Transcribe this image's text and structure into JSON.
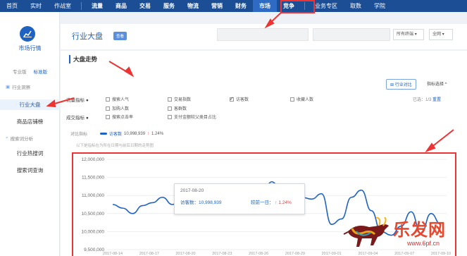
{
  "nav": {
    "items": [
      "首页",
      "实时",
      "作战室",
      "流量",
      "商品",
      "交易",
      "服务",
      "物流",
      "营销",
      "财务",
      "市场",
      "竞争",
      "业务专区",
      "取数",
      "学院"
    ],
    "active_index": 10
  },
  "sidebar": {
    "logo_title": "市场行情",
    "tabs": [
      "专业版",
      "标准版"
    ],
    "section1": "行业洞察",
    "items1": [
      "行业大盘",
      "商品店铺榜"
    ],
    "section2": "搜索词分析",
    "items2": [
      "行业热搜词",
      "搜索词查询"
    ]
  },
  "header": {
    "title": "行业大盘",
    "badge": "查看",
    "select1": "所有终端",
    "select2": "全网"
  },
  "section": {
    "title": "大盘走势",
    "compare_button": "行业对比",
    "indicator_link": "指标选择 ^",
    "selected_count": "已选：1/3",
    "reset_link": "重置"
  },
  "filters": {
    "row1_label": "流量指标",
    "row2_label": "成交指标",
    "options": [
      {
        "label": "搜索人气",
        "checked": false
      },
      {
        "label": "交易指数",
        "checked": false
      },
      {
        "label": "访客数",
        "checked": true
      },
      {
        "label": "收藏人数",
        "checked": false
      },
      {
        "label": "加购人数",
        "checked": false
      },
      {
        "label": "客群数",
        "checked": false
      },
      {
        "label": "搜索点击率",
        "checked": false
      },
      {
        "label": "支付金额较父类目占比",
        "checked": false
      }
    ]
  },
  "legend": {
    "compare_label": "对比指标",
    "series_label": "访客数",
    "series_value": "10,998,939",
    "change": "1.24%",
    "hint": "以下是指标在为所在日期与前后日期的走势图"
  },
  "tooltip": {
    "date": "2017-08-20",
    "metric_label": "访客数：",
    "metric_value": "10,998,939",
    "compare_label": "较前一日：",
    "compare_value": "1.24%"
  },
  "watermark": {
    "brand": "乐发网",
    "url": "www.6pf.cn"
  },
  "chart_data": {
    "type": "line",
    "title": "",
    "xlabel": "",
    "ylabel": "",
    "yticks": [
      "12,000,000",
      "11,500,000",
      "11,000,000",
      "10,500,000",
      "10,000,000",
      "9,500,000"
    ],
    "ylim": [
      9500000,
      12000000
    ],
    "x_labels": [
      "2017-08-14",
      "2017-08-17",
      "2017-08-20",
      "2017-08-23",
      "2017-08-26",
      "2017-08-29",
      "2017-09-01",
      "2017-09-04",
      "2017-09-07",
      "2017-09-10"
    ],
    "series": [
      {
        "name": "访客数",
        "color": "#1e62c2",
        "values": [
          10750000,
          10650000,
          10500000,
          10720000,
          10800000,
          10950000,
          10750000,
          10999000,
          10980000,
          11000000,
          11050000,
          10980000,
          10940000,
          10960000,
          11030000,
          11000000,
          11380000,
          11050000,
          10980000,
          10950000,
          10900000,
          11050000,
          10200000,
          10350000,
          10950000,
          11150000,
          10580000,
          10000000,
          9900000,
          10150000,
          10550000,
          9950000,
          10500000,
          10200000
        ]
      }
    ]
  }
}
